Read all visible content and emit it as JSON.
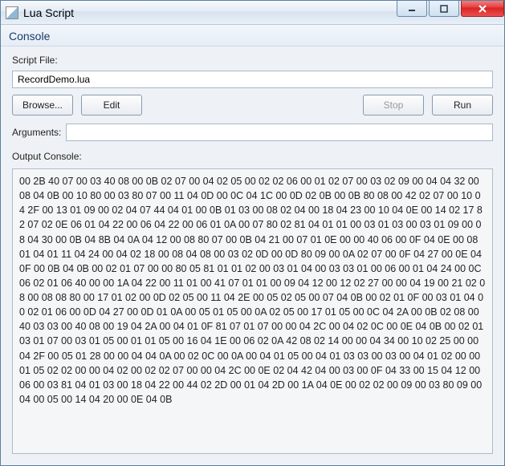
{
  "window": {
    "title": "Lua Script"
  },
  "section": {
    "console_header": "Console"
  },
  "script_file": {
    "label": "Script File:",
    "value": "RecordDemo.lua"
  },
  "buttons": {
    "browse": "Browse...",
    "edit": "Edit",
    "stop": "Stop",
    "run": "Run"
  },
  "arguments": {
    "label": "Arguments:",
    "value": ""
  },
  "output": {
    "label": "Output Console:",
    "text": "00 2B 40 07 00 03 40 08 00 0B 02 07 00 04 02 05 00 02 02 06 00 01 02 07 00 03 02 09 00 04 04 32 00 08 04 0B 00 10 80 00 03 80 07 00 11 04 0D 00 0C 04 1C 00 0D 02 0B 00 0B 80 08 00 42 02 07 00 10 04 2F 00 13 01 09 00 02 04 07 44 04 01 00 0B 01 03 00 08 02 04 00 18 04 23 00 10 04 0E 00 14 02 17 82 07 02 0E 06 01 04 22 00 06 04 22 00 06 01 0A 00 07 80 02 81 04 01 01 00 03 01 03 00 03 01 09 00 08 04 30 00 0B 04 8B 04 0A 04 12 00 08 80 07 00 0B 04 21 00 07 01 0E 00 00 40 06 00 0F 04 0E 00 08 01 04 01 11 04 24 00 04 02 18 00 08 04 08 00 03 02 0D 00 0D 80 09 00 0A 02 07 00 0F 04 27 00 0E 04 0F 00 0B 04 0B 00 02 01 07 00 00 80 05 81 01 01 02 00 03 01 04 00 03 03 01 00 06 00 01 04 24 00 0C 06 02 01 06 40 00 00 1A 04 22 00 11 01 00 41 07 01 01 00 09 04 12 00 12 02 27 00 00 04 19 00 21 02 08 00 08 08 80 00 17 01 02 00 0D 02 05 00 11 04 2E 00 05 02 05 00 07 04 0B 00 02 01 0F 00 03 01 04 00 02 01 06 00 0D 04 27 00 0D 01 0A 00 05 01 05 00 0A 02 05 00 17 01 05 00 0C 04 2A 00 0B 02 08 00 40 03 03 00 40 08 00 19 04 2A 00 04 01 0F 81 07 01 07 00 00 04 2C 00 04 02 0C 00 0E 04 0B 00 02 01 03 01 07 00 03 01 05 00 01 01 05 00 16 04 1E 00 06 02 0A 42 08 02 14 00 00 04 34 00 10 02 25 00 00 04 2F 00 05 01 28 00 00 04 04 0A 00 02 0C 00 0A 00 04 01 05 00 04 01 03 03 00 03 00 04 01 02 00 00 01 05 02 02 00 00 04 02 00 02 02 07 00 00 04 2C 00 0E 02 04 42 04 00 03 00 0F 04 33 00 15 04 12 00 06 00 03 81 04 01 03 00 18 04 22 00 44 02 2D 00 01 04 2D 00 1A 04 0E 00 02 02 00 09 00 03 80 09 00 04 00 05 00 14 04 20 00 0E 04 0B"
  },
  "state": {
    "stop_disabled": true
  }
}
